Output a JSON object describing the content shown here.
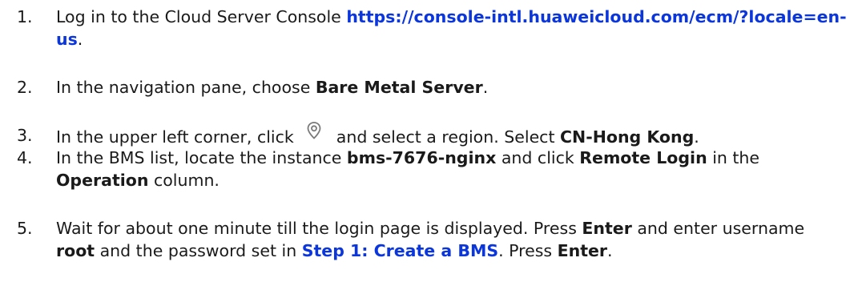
{
  "steps": [
    {
      "number": "1.",
      "text_a": "Log in to the Cloud Server Console ",
      "link": "https://console-intl.huaweicloud.com/ecm/?locale=en-us",
      "text_b": "."
    },
    {
      "number": "2.",
      "text_a": "In the navigation pane, choose ",
      "bold": "Bare Metal Server",
      "text_b": "."
    },
    {
      "number": "3.",
      "text_a": "In the upper left corner, click ",
      "icon": "location-pin-icon",
      "text_b": " and select a region. Select ",
      "bold": "CN-Hong Kong",
      "text_c": "."
    },
    {
      "number": "4.",
      "text_a": "In the BMS list, locate the instance ",
      "bold_a": "bms-7676-nginx",
      "text_b": " and click ",
      "bold_b": "Remote Login",
      "text_c": " in the ",
      "bold_c": "Operation",
      "text_d": " column."
    },
    {
      "number": "5.",
      "text_a": "Wait for about one minute till the login page is displayed. Press ",
      "bold_a": "Enter",
      "text_b": " and enter username ",
      "bold_b": "root",
      "text_c": " and the password set in ",
      "link": "Step 1: Create a BMS",
      "text_d": ". Press ",
      "bold_c": "Enter",
      "text_e": "."
    }
  ],
  "colors": {
    "link": "#0b36dc",
    "text": "#1a1a1a",
    "icon": "#7a7a7a"
  }
}
